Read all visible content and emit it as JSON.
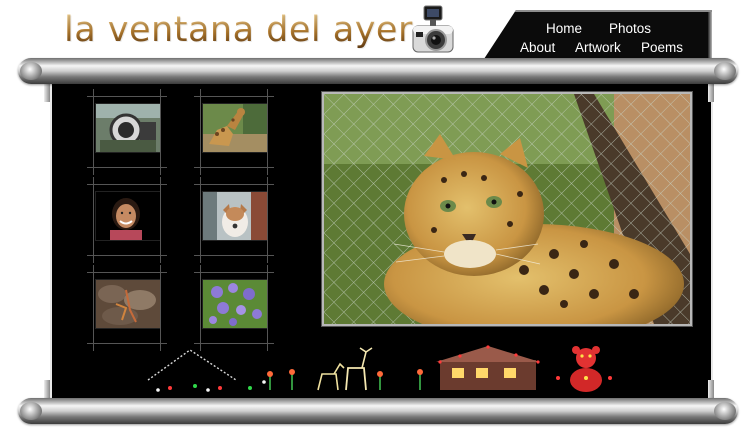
{
  "site": {
    "title": "la ventana del ayer",
    "logo_icon": "camera-icon"
  },
  "nav": {
    "items": [
      {
        "label": "Home"
      },
      {
        "label": "Photos"
      },
      {
        "label": "About"
      },
      {
        "label": "Artwork"
      },
      {
        "label": "Poems"
      }
    ]
  },
  "gallery": {
    "thumbnails": [
      {
        "subject": "camera-lens-photo"
      },
      {
        "subject": "giraffe-photo"
      },
      {
        "subject": "smiling-girl-photo"
      },
      {
        "subject": "dog-photo"
      },
      {
        "subject": "rocks-photo"
      },
      {
        "subject": "purple-flowers-photo"
      }
    ],
    "main_photo": {
      "subject": "leopard-photo"
    }
  },
  "colors": {
    "panel": "#000000",
    "title_gold": "#b27b2f",
    "nav_bg": "#0b0b0b",
    "nav_text": "#ffffff"
  }
}
